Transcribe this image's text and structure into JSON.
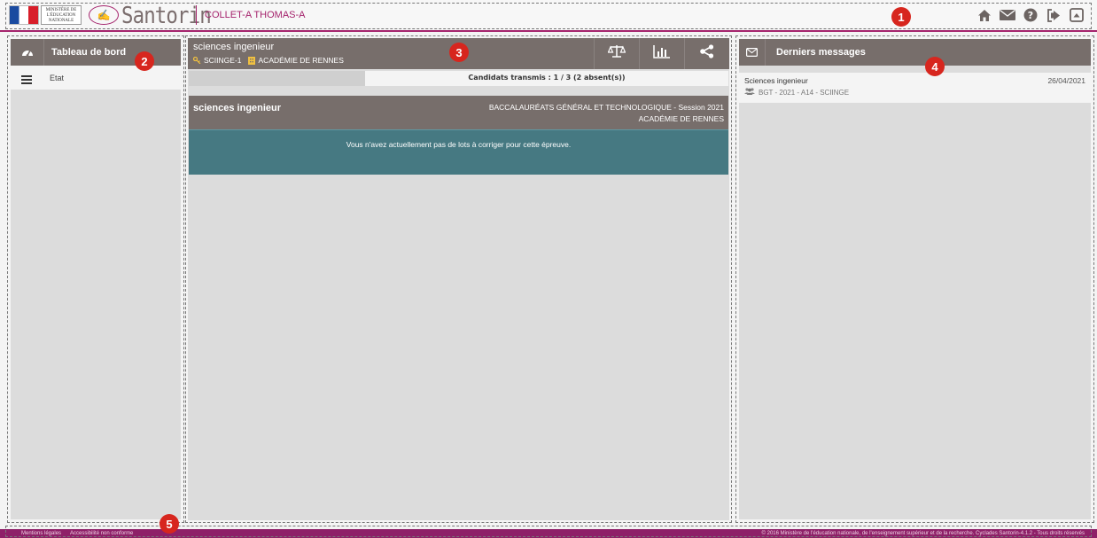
{
  "header": {
    "ministry_logo_text": "MINISTÈRE DE L'ÉDUCATION NATIONALE",
    "app_logo": "Santorin",
    "user_name": "COLLET-A THOMAS-A",
    "icons": [
      "home-icon",
      "envelope-icon",
      "help-icon",
      "logout-icon",
      "collapse-icon"
    ]
  },
  "callouts": [
    "1",
    "2",
    "3",
    "4",
    "5"
  ],
  "left_panel": {
    "title": "Tableau de bord",
    "items": [
      {
        "label": "Etat",
        "icon": "menu-icon"
      }
    ]
  },
  "main_panel": {
    "title": "sciences ingenieur",
    "code": "SCIINGE-1",
    "academy": "ACADÉMIE DE RENNES",
    "tools": [
      "balance-icon",
      "bar-chart-icon",
      "share-icon"
    ],
    "candidates_text": "Candidats transmis : 1 / 3 (2 absent(s))",
    "exam": {
      "title": "sciences ingenieur",
      "session": "BACCALAURÉATS GÉNÉRAL ET TECHNOLOGIQUE - Session 2021",
      "academy": "ACADÉMIE DE RENNES"
    },
    "info_message": "Vous n'avez actuellement pas de lots à corriger pour cette épreuve."
  },
  "right_panel": {
    "title": "Derniers messages",
    "messages": [
      {
        "subject": "Sciences ingenieur",
        "date": "26/04/2021",
        "detail": "BGT - 2021 - A14 - SCIINGE"
      }
    ]
  },
  "footer": {
    "legal": "Mentions légales",
    "accessibility": "Accessibilité non conforme",
    "copyright": "© 2016 Ministère de l'éducation nationale, de l'enseignement supérieur et de la recherche. Cyclades Santorin-4.1.2 - Tous droits réservés"
  },
  "colors": {
    "accent": "#a5246d",
    "panel_head": "#776e6b",
    "info": "#467982",
    "callout": "#d7261e",
    "footer": "#8e2068"
  }
}
